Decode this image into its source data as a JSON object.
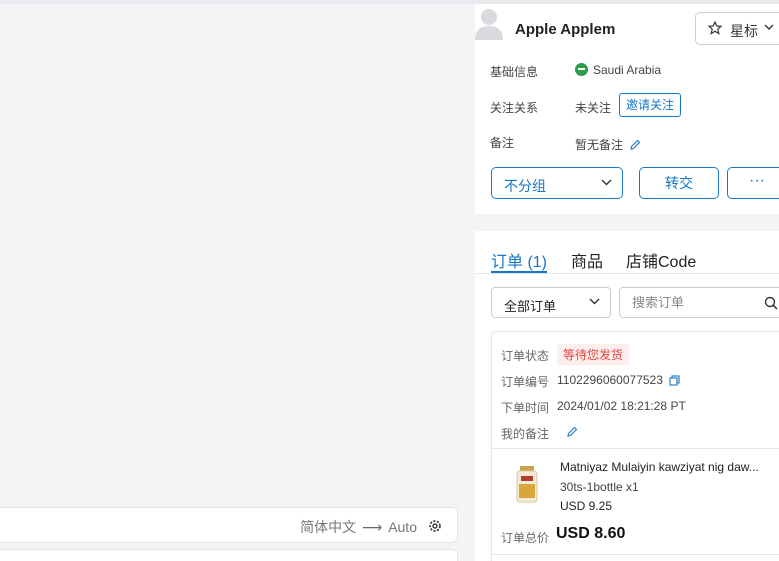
{
  "translation": {
    "source_lang": "简体中文",
    "arrow": "⟶",
    "target_lang": "Auto"
  },
  "profile": {
    "name": "Apple Applem",
    "star_label": "星标",
    "basic_info_label": "基础信息",
    "country": "Saudi Arabia",
    "follow_label": "关注关系",
    "follow_status": "未关注",
    "invite_label": "邀请关注",
    "note_label": "备注",
    "note_value": "暂无备注",
    "group_label": "不分组",
    "transfer_label": "转交",
    "more_label": "···"
  },
  "orders": {
    "tabs": [
      {
        "label": "订单 (1)",
        "active": true
      },
      {
        "label": "商品",
        "active": false
      },
      {
        "label": "店铺Code",
        "active": false
      }
    ],
    "filter_label": "全部订单",
    "search_placeholder": "搜索订单",
    "order": {
      "status_label": "订单状态",
      "status_value": "等待您发货",
      "number_label": "订单编号",
      "number_value": "1102296060077523",
      "time_label": "下单时间",
      "time_value": "2024/01/02 18:21:28 PT",
      "my_note_label": "我的备注",
      "product_name": "Matniyaz Mulaiyin kawziyat nig daw...",
      "product_variant": "30ts-1bottle x1",
      "product_price": "USD 9.25",
      "total_label": "订单总价",
      "total_value": "USD 8.60"
    }
  },
  "colors": {
    "accent": "#1677c8",
    "status_red": "#e0443b",
    "status_bg": "#fdeeee"
  }
}
